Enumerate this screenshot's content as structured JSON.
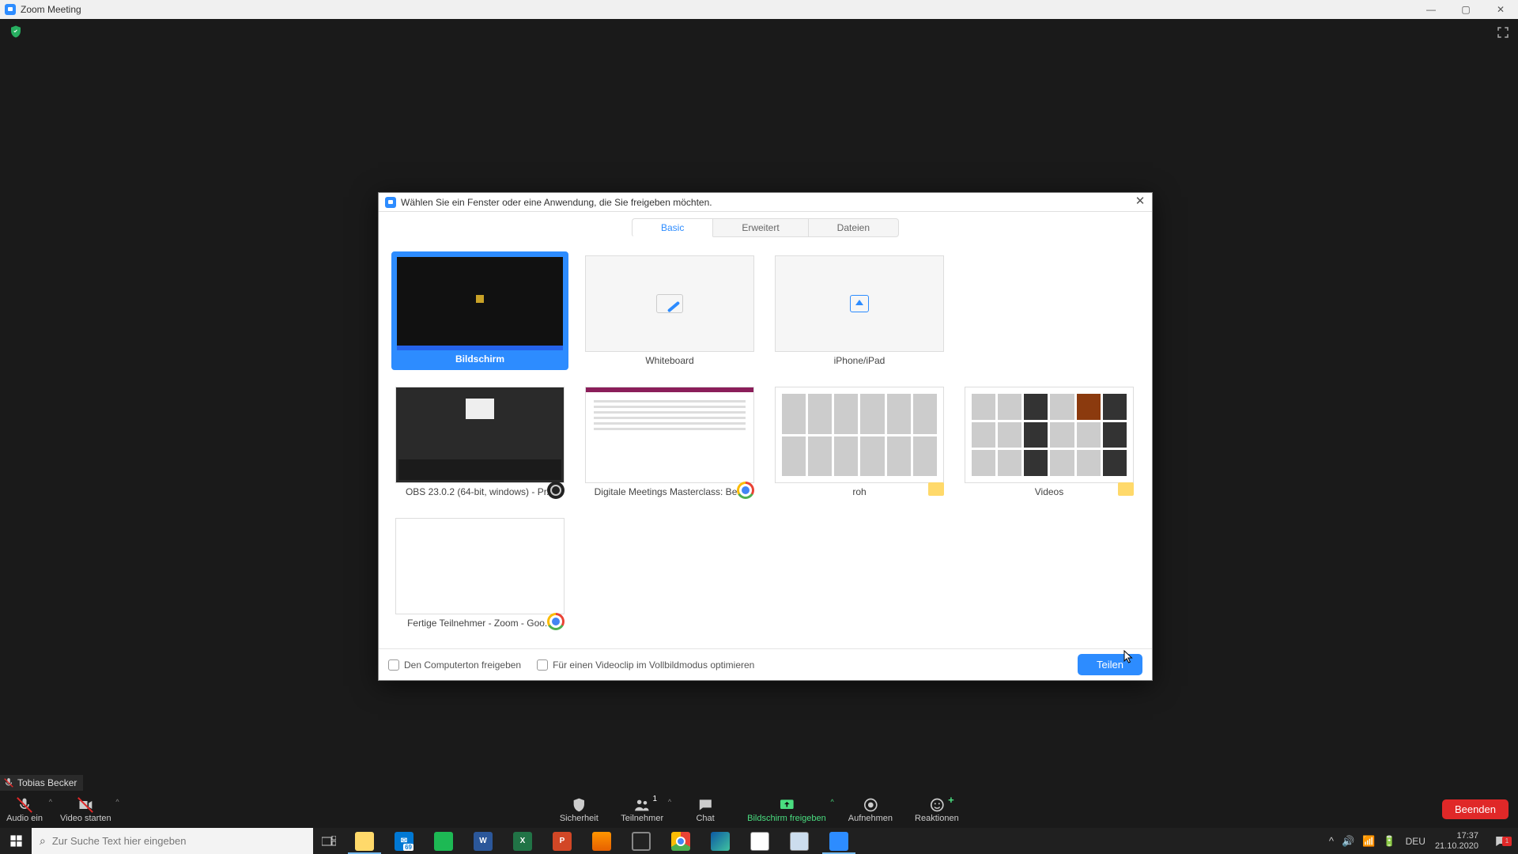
{
  "titlebar": {
    "title": "Zoom Meeting"
  },
  "participant": "Tobias Becker",
  "toolbar": {
    "audio": "Audio ein",
    "video": "Video starten",
    "security": "Sicherheit",
    "participants": "Teilnehmer",
    "participants_count": "1",
    "chat": "Chat",
    "share": "Bildschirm freigeben",
    "record": "Aufnehmen",
    "reactions": "Reaktionen",
    "end": "Beenden"
  },
  "dialog": {
    "title": "Wählen Sie ein Fenster oder eine Anwendung, die Sie freigeben möchten.",
    "tabs": {
      "basic": "Basic",
      "advanced": "Erweitert",
      "files": "Dateien"
    },
    "items": {
      "screen": "Bildschirm",
      "whiteboard": "Whiteboard",
      "iphone": "iPhone/iPad",
      "obs": "OBS 23.0.2 (64-bit, windows) - Pr...",
      "chrome1": "Digitale Meetings Masterclass: Be...",
      "roh": "roh",
      "videos": "Videos",
      "chrome2": "Fertige Teilnehmer - Zoom - Goo..."
    },
    "check_audio": "Den Computerton freigeben",
    "check_video": "Für einen Videoclip im Vollbildmodus optimieren",
    "share_btn": "Teilen"
  },
  "taskbar": {
    "search_placeholder": "Zur Suche Text hier eingeben",
    "mail_badge": "69",
    "lang": "DEU",
    "time": "17:37",
    "date": "21.10.2020",
    "notif_count": "1"
  }
}
